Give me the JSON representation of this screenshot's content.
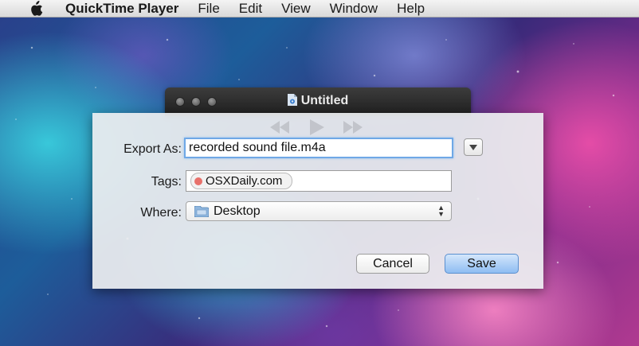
{
  "menubar": {
    "apple_icon": "apple-logo-icon",
    "app_name": "QuickTime Player",
    "items": [
      "File",
      "Edit",
      "View",
      "Window",
      "Help"
    ]
  },
  "window": {
    "title": "Untitled",
    "title_icon": "document-icon"
  },
  "export_sheet": {
    "export_label": "Export As:",
    "export_value": "recorded sound file.m4a",
    "tags_label": "Tags:",
    "tag": {
      "name": "OSXDaily.com",
      "color": "#e8716b"
    },
    "where_label": "Where:",
    "where_value": "Desktop",
    "where_icon": "folder-icon",
    "expand_icon": "chevron-down-icon",
    "cancel_label": "Cancel",
    "save_label": "Save"
  },
  "colors": {
    "save_button": "#8ebdf2",
    "focus_ring": "#6fa8e6"
  }
}
